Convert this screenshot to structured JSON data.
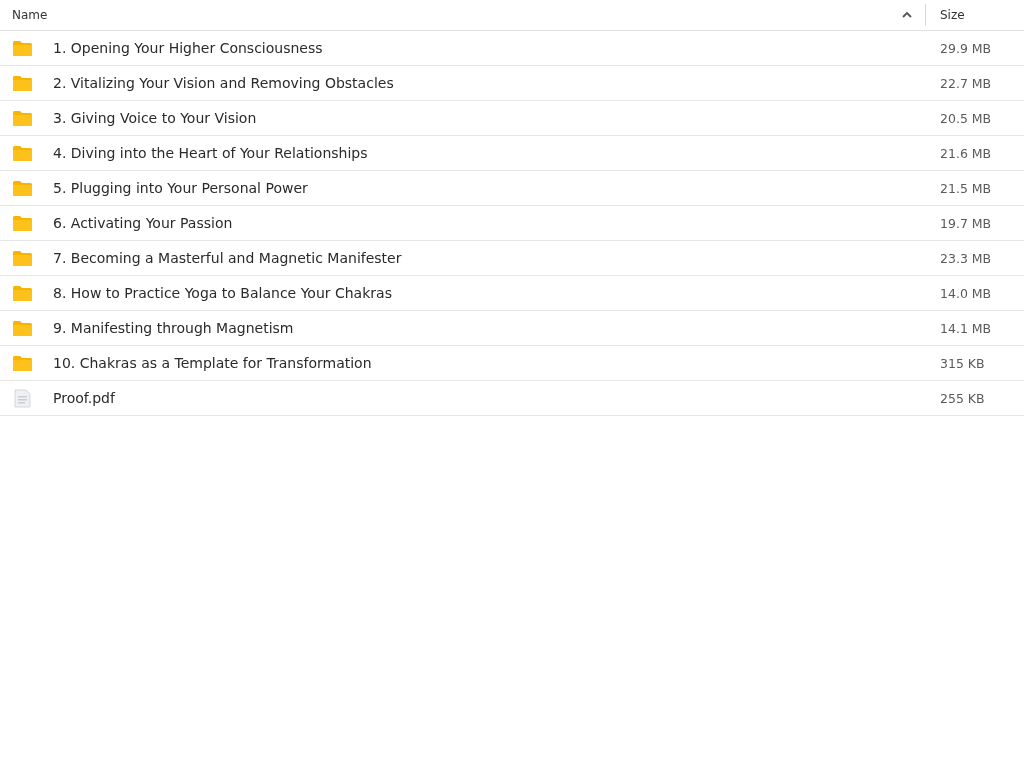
{
  "columns": [
    {
      "label": "Name",
      "sorted": true
    },
    {
      "label": "Size",
      "sorted": false
    }
  ],
  "rows": [
    {
      "kind": "folder",
      "name": "1. Opening Your Higher Consciousness",
      "size": "29.9 MB"
    },
    {
      "kind": "folder",
      "name": "2. Vitalizing Your Vision and Removing Obstacles",
      "size": "22.7 MB"
    },
    {
      "kind": "folder",
      "name": "3. Giving Voice to Your Vision",
      "size": "20.5 MB"
    },
    {
      "kind": "folder",
      "name": "4. Diving into the Heart of Your Relationships",
      "size": "21.6 MB"
    },
    {
      "kind": "folder",
      "name": "5. Plugging into Your Personal Power",
      "size": "21.5 MB"
    },
    {
      "kind": "folder",
      "name": "6. Activating Your Passion",
      "size": "19.7 MB"
    },
    {
      "kind": "folder",
      "name": "7. Becoming a Masterful and Magnetic Manifester",
      "size": "23.3 MB"
    },
    {
      "kind": "folder",
      "name": "8. How to Practice Yoga to Balance Your Chakras",
      "size": "14.0 MB"
    },
    {
      "kind": "folder",
      "name": "9. Manifesting through Magnetism",
      "size": "14.1 MB"
    },
    {
      "kind": "folder",
      "name": "10. Chakras as a Template for Transformation",
      "size": "315 KB"
    },
    {
      "kind": "pdf",
      "name": "Proof.pdf",
      "size": "255 KB"
    }
  ]
}
